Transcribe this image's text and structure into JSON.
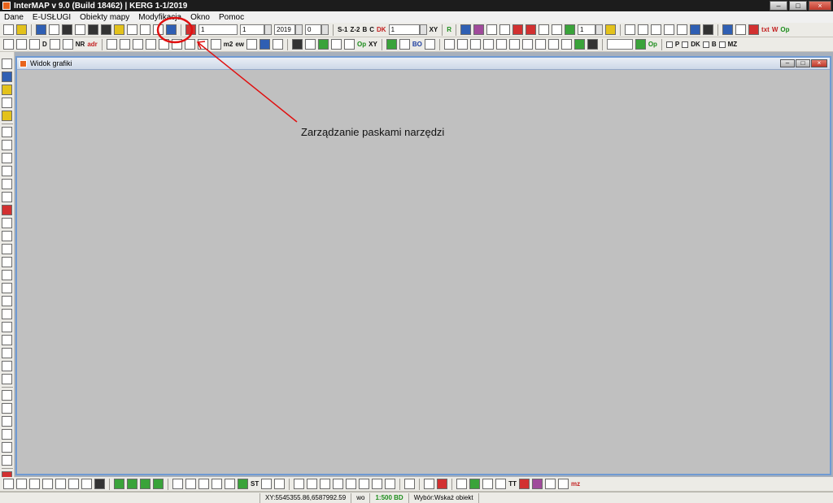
{
  "app": {
    "title": "InterMAP v 9.0 (Build 18462) | KERG 1-1/2019",
    "window_controls": {
      "minimize": "–",
      "maximize": "□",
      "close": "×"
    }
  },
  "menu": [
    "Dane",
    "E-USŁUGI",
    "Obiekty mapy",
    "Modyfikacja",
    "Okno",
    "Pomoc"
  ],
  "toolbar1": {
    "field_k": "1",
    "field_2": "1",
    "field_year": "2019",
    "field_4": "0",
    "labels": [
      "S-1",
      "Z-2",
      "B",
      "C",
      "DK"
    ],
    "field_5": "1",
    "xy_label": "XY",
    "r_label": "R",
    "field_6": "1",
    "txt_label": "txt",
    "w_label": "W",
    "op_label": "Op"
  },
  "toolbar2": {
    "nr_label": "NR",
    "adr_label": "adr",
    "d_label": "D",
    "m2_label": "m2",
    "ew_label": "ew",
    "op_label": "Op",
    "xy_label": "XY",
    "bo_label": "BO",
    "op2_label": "Op",
    "checkbox_labels": [
      "P",
      "DK",
      "B",
      "MZ"
    ]
  },
  "graphics_window": {
    "title": "Widok grafiki"
  },
  "annotation": {
    "text": "Zarządzanie paskami narzędzi",
    "color": "#e01010"
  },
  "bottom_toolbar": {
    "st_label": "ST",
    "tt_label": "TT",
    "mz_label": "mz"
  },
  "statusbar": {
    "coords": "XY:5545355.86,6587992.59",
    "layer": "wo",
    "scale": "1:500 BD",
    "selection": "Wybór:Wskaż obiekt"
  }
}
